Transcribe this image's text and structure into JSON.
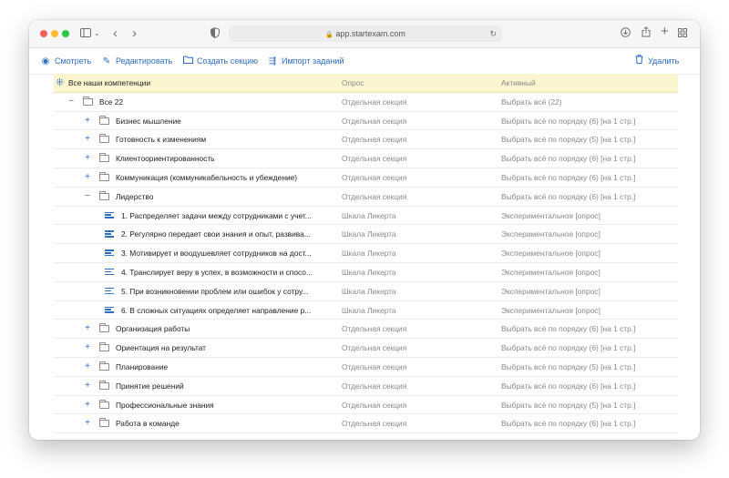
{
  "browser": {
    "url": "app.startexam.com"
  },
  "toolbar": {
    "view_label": "Смотреть",
    "edit_label": "Редактировать",
    "create_section_label": "Создать секцию",
    "import_label": "Импорт заданий",
    "delete_label": "Удалить"
  },
  "tree": {
    "header": {
      "name": "Все наши компетенции",
      "type": "Опрос",
      "active": "Активный"
    },
    "rows": [
      {
        "name": "Все 22",
        "type": "Отдельная секция",
        "active": "Выбрать всё (22)",
        "toggle": "−"
      },
      {
        "name": "Бизнес мышление",
        "type": "Отдельная секция",
        "active": "Выбрать всё по порядку (6) [на 1 стр.]",
        "toggle": "+"
      },
      {
        "name": "Готовность к изменениям",
        "type": "Отдельная секция",
        "active": "Выбрать всё по порядку (5) [на 1 стр.]",
        "toggle": "+"
      },
      {
        "name": "Клиентоориентированность",
        "type": "Отдельная секция",
        "active": "Выбрать всё по порядку (6) [на 1 стр.]",
        "toggle": "+"
      },
      {
        "name": "Коммуникация (коммуникабельность и убеждение)",
        "type": "Отдельная секция",
        "active": "Выбрать всё по порядку (6) [на 1 стр.]",
        "toggle": "+"
      },
      {
        "name": "Лидерство",
        "type": "Отдельная секция",
        "active": "Выбрать всё по порядку (6) [на 1 стр.]",
        "toggle": "−"
      },
      {
        "name": "1. Распределяет задачи между сотрудниками с учет...",
        "type": "Шкала Ликерта",
        "active": "Экспериментальное [опрос]"
      },
      {
        "name": "2. Регулярно передает свои знания и опыт, развива...",
        "type": "Шкала Ликерта",
        "active": "Экспериментальное [опрос]"
      },
      {
        "name": "3. Мотивирует и воодушевляет сотрудников на дост...",
        "type": "Шкала Ликерта",
        "active": "Экспериментальное [опрос]"
      },
      {
        "name": "4. Транслирует веру в успех, в возможности и спосо...",
        "type": "Шкала Ликерта",
        "active": "Экспериментальное [опрос]"
      },
      {
        "name": "5. При возникновении проблем или ошибок у сотру...",
        "type": "Шкала Ликерта",
        "active": "Экспериментальное [опрос]"
      },
      {
        "name": "6. В сложных ситуациях определяет направление р...",
        "type": "Шкала Ликерта",
        "active": "Экспериментальное [опрос]"
      },
      {
        "name": "Организация работы",
        "type": "Отдельная секция",
        "active": "Выбрать всё по порядку (6) [на 1 стр.]",
        "toggle": "+"
      },
      {
        "name": "Ориентация на результат",
        "type": "Отдельная секция",
        "active": "Выбрать всё по порядку (6) [на 1 стр.]",
        "toggle": "+"
      },
      {
        "name": "Планирование",
        "type": "Отдельная секция",
        "active": "Выбрать всё по порядку (5) [на 1 стр.]",
        "toggle": "+"
      },
      {
        "name": "Принятие решений",
        "type": "Отдельная секция",
        "active": "Выбрать всё по порядку (6) [на 1 стр.]",
        "toggle": "+"
      },
      {
        "name": "Профессиональные знания",
        "type": "Отдельная секция",
        "active": "Выбрать всё по порядку (5) [на 1 стр.]",
        "toggle": "+"
      },
      {
        "name": "Работа в команде",
        "type": "Отдельная секция",
        "active": "Выбрать всё по порядку (6) [на 1 стр.]",
        "toggle": "+"
      }
    ]
  }
}
